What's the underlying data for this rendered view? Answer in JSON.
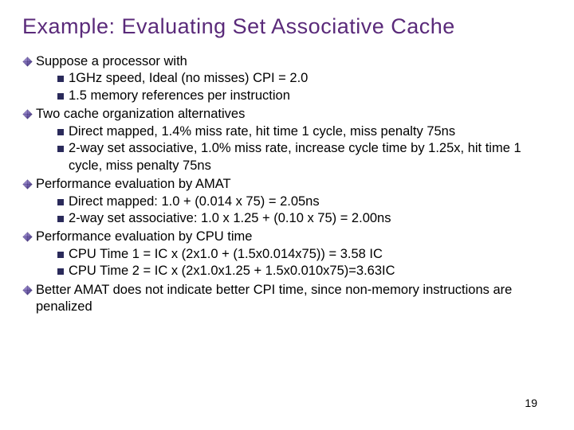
{
  "title": "Example: Evaluating Set Associative Cache",
  "items": [
    {
      "level": 1,
      "text": "Suppose a processor with"
    },
    {
      "level": 2,
      "text": "1GHz speed, Ideal (no misses) CPI = 2.0"
    },
    {
      "level": 2,
      "text": "1.5 memory references per instruction"
    },
    {
      "level": 1,
      "text": "Two cache organization alternatives"
    },
    {
      "level": 2,
      "text": "Direct mapped, 1.4% miss rate, hit time 1 cycle, miss penalty 75ns"
    },
    {
      "level": 2,
      "text": "2-way set associative, 1.0% miss rate, increase cycle time by 1.25x, hit time 1 cycle, miss penalty 75ns"
    },
    {
      "level": 1,
      "text": "Performance evaluation by AMAT"
    },
    {
      "level": 2,
      "text": "Direct mapped: 1.0 + (0.014 x 75) = 2.05ns"
    },
    {
      "level": 2,
      "text": "2-way set associative: 1.0 x 1.25 + (0.10 x 75) = 2.00ns"
    },
    {
      "level": 1,
      "text": "Performance evaluation by CPU time"
    },
    {
      "level": 2,
      "text": "CPU Time 1 = IC x (2x1.0 + (1.5x0.014x75)) = 3.58 IC"
    },
    {
      "level": 2,
      "text": "CPU Time 2 = IC x (2x1.0x1.25 + 1.5x0.010x75)=3.63IC"
    },
    {
      "level": 1,
      "text": "Better AMAT does not indicate better CPI time, since non-memory instructions are penalized"
    }
  ],
  "pageNumber": "19"
}
